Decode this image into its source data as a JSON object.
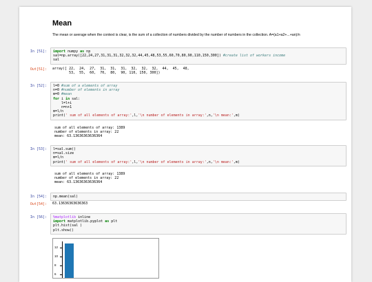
{
  "heading": "Mean",
  "description": "The mean or average when the context is clear, is the sum of a collection of numbers divided by the number of numbers in the collection. A=(a1+a2+...+an)/n",
  "cells": [
    {
      "in": "In [51]:",
      "out": "Out[51]:"
    },
    {
      "in": "In [52]:"
    },
    {
      "in": "In [53]:"
    },
    {
      "in": "In [54]:",
      "out": "Out[54]:"
    },
    {
      "in": "In [56]:"
    }
  ],
  "c51": {
    "l1_kw1": "import",
    "l1_mod": " numpy ",
    "l1_kw2": "as",
    "l1_alias": " np",
    "l2_code": "sal=np.array([22,24,27,31,31,31,32,32,32,44,45,48,53,55,60,70,80,90,110,150,300]) ",
    "l2_comment": "#create list of workers income",
    "l3": "sal",
    "out_l1": "array([ 22,  24,  27,  31,  31,  31,  32,  32,  32,  44,  45,  48,",
    "out_l2": "        53,  55,  60,  70,  80,  90, 110, 150, 300])"
  },
  "c52": {
    "l1_code": "l=0 ",
    "l1_comment": "#sum of a elements of array",
    "l2_code": "n=0 ",
    "l2_comment": "#number of elements in array",
    "l3_code": "m=0 ",
    "l3_comment": "#mean",
    "l4_kw1": "for",
    "l4_mid": " i ",
    "l4_kw2": "in",
    "l4_end": " sal:",
    "l5": "    l=l+i",
    "l6": "    n=n+1",
    "l7": "m=l/n",
    "l8_pre": "print(",
    "l8_str1": "' sum of all elements of array:'",
    "l8_mid1": ",l,",
    "l8_str2": "'\\n number of elements in array:'",
    "l8_mid2": ",n,",
    "l8_str3": "'\\n mean:'",
    "l8_end": ",m)",
    "out_l1": " sum of all elements of array: 1389",
    "out_l2": " number of elements in array: 22",
    "out_l3": " mean: 63.13636363636364"
  },
  "c53": {
    "l1": "l=sal.sum()",
    "l2": "n=sal.size",
    "l3": "m=l/n",
    "l4_pre": "print(",
    "l4_str1": "' sum of all elements of array:'",
    "l4_mid1": ",l,",
    "l4_str2": "'\\n number of elements in array:'",
    "l4_mid2": ",n,",
    "l4_str3": "'\\n mean:'",
    "l4_end": ",m)",
    "out_l1": " sum of all elements of array: 1389",
    "out_l2": " number of elements in array: 22",
    "out_l3": " mean: 63.13636363636364"
  },
  "c54": {
    "code": "np.mean(sal)",
    "out": "63.13636363636363"
  },
  "c56": {
    "l1_magic": "%matplotlib",
    "l1_rest": " inline",
    "l2_kw1": "import",
    "l2_mod": " matplotlib.pyplot ",
    "l2_kw2": "as",
    "l2_alias": " plt",
    "l3": "plt.hist(sal )",
    "l4": "plt.show()"
  },
  "chart_data": {
    "type": "bar",
    "yticks": [
      "12",
      "10",
      "8",
      "6"
    ],
    "bar_color": "#1f77b4",
    "values": [
      13
    ],
    "ylim": [
      5,
      14
    ]
  }
}
